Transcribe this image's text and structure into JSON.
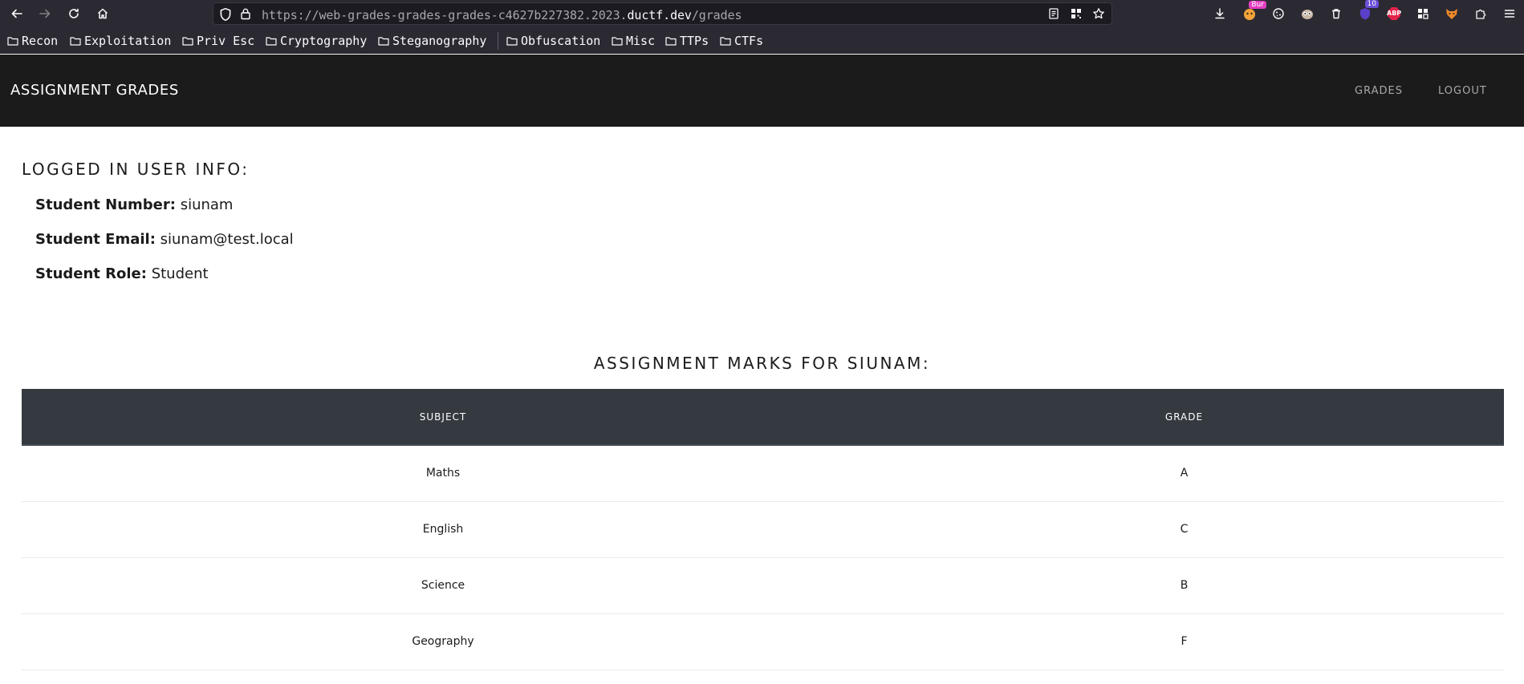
{
  "browser": {
    "url_prefix": "https://web-grades-grades-grades-c4627b227382.2023.",
    "url_domain": "ductf.dev",
    "url_path": "/grades",
    "extensions": [
      {
        "icon": "burp-icon",
        "badge": "Bur",
        "badge_color": "#e33ec0"
      },
      {
        "icon": "cookie-icon"
      },
      {
        "icon": "owl-icon"
      },
      {
        "icon": "trash-icon"
      },
      {
        "icon": "shield-ext-icon",
        "badge": "10",
        "badge_color": "#6a4fd8"
      },
      {
        "icon": "adblock-icon",
        "label": "ABP",
        "color": "#e4234a"
      },
      {
        "icon": "grid-ext-icon"
      },
      {
        "icon": "fox-icon"
      },
      {
        "icon": "puzzle-icon"
      },
      {
        "icon": "hamburger-menu-icon"
      }
    ],
    "bookmarks": [
      "Recon",
      "Exploitation",
      "Priv Esc",
      "Cryptography",
      "Steganography",
      "Obfuscation",
      "Misc",
      "TTPs",
      "CTFs"
    ]
  },
  "navbar": {
    "brand": "ASSIGNMENT GRADES",
    "links": [
      "GRADES",
      "LOGOUT"
    ]
  },
  "user_info": {
    "heading": "LOGGED IN USER INFO:",
    "number_label": "Student Number:",
    "number_value": "siunam",
    "email_label": "Student Email:",
    "email_value": "siunam@test.local",
    "role_label": "Student Role:",
    "role_value": "Student"
  },
  "marks": {
    "heading": "ASSIGNMENT MARKS FOR SIUNAM:",
    "columns": [
      "SUBJECT",
      "GRADE"
    ],
    "rows": [
      [
        "Maths",
        "A"
      ],
      [
        "English",
        "C"
      ],
      [
        "Science",
        "B"
      ],
      [
        "Geography",
        "F"
      ]
    ]
  },
  "colors": {
    "navbar_bg": "#1b1b1b",
    "table_header_bg": "#343a40",
    "chrome_bg": "#2b2a33"
  }
}
